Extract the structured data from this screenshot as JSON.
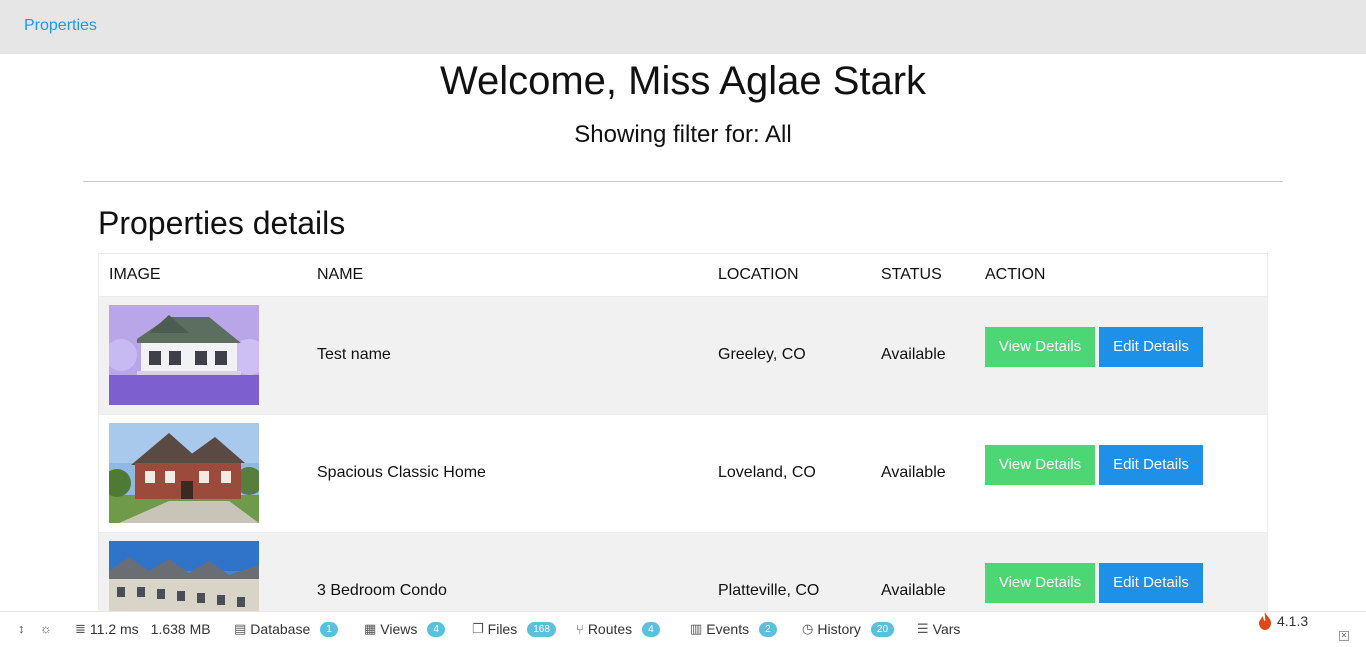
{
  "nav": {
    "brand": "Properties"
  },
  "header": {
    "welcome": "Welcome, Miss Aglae Stark",
    "filter": "Showing filter for: All"
  },
  "section": {
    "title": "Properties details"
  },
  "table": {
    "headers": {
      "image": "IMAGE",
      "name": "NAME",
      "location": "LOCATION",
      "status": "STATUS",
      "action": "ACTION"
    },
    "rows": [
      {
        "name": "Test name",
        "location": "Greeley, CO",
        "status": "Available",
        "view": "View Details",
        "edit": "Edit Details"
      },
      {
        "name": "Spacious Classic Home",
        "location": "Loveland, CO",
        "status": "Available",
        "view": "View Details",
        "edit": "Edit Details"
      },
      {
        "name": "3 Bedroom Condo",
        "location": "Platteville, CO",
        "status": "Available",
        "view": "View Details",
        "edit": "Edit Details"
      }
    ]
  },
  "debugbar": {
    "time": "11.2 ms",
    "memory": "1.638 MB",
    "database": {
      "label": "Database",
      "count": "1"
    },
    "views": {
      "label": "Views",
      "count": "4"
    },
    "files": {
      "label": "Files",
      "count": "168"
    },
    "routes": {
      "label": "Routes",
      "count": "4"
    },
    "events": {
      "label": "Events",
      "count": "2"
    },
    "history": {
      "label": "History",
      "count": "20"
    },
    "vars": {
      "label": "Vars"
    },
    "version": "4.1.3"
  },
  "colors": {
    "accent": "#2196f3",
    "view_button": "#4cd774",
    "edit_button": "#1e90e8",
    "badge": "#5bc0de"
  }
}
